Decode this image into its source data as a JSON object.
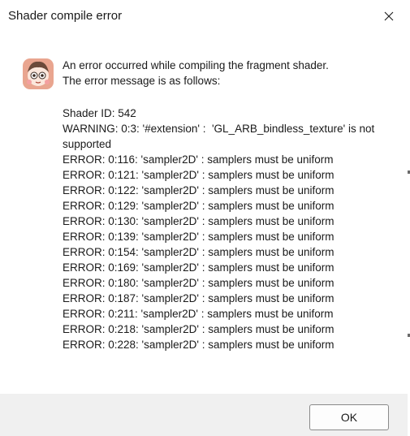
{
  "window": {
    "title": "Shader compile error",
    "close_icon": "close-icon"
  },
  "message": {
    "icon": "app-mascot-icon",
    "heading_line1": "An error occurred while compiling the fragment shader.",
    "heading_line2": "The error message is as follows:",
    "details": [
      "Shader ID: 542",
      "WARNING: 0:3: '#extension' :  'GL_ARB_bindless_texture' is not supported",
      "ERROR: 0:116: 'sampler2D' : samplers must be uniform",
      "ERROR: 0:121: 'sampler2D' : samplers must be uniform",
      "ERROR: 0:122: 'sampler2D' : samplers must be uniform",
      "ERROR: 0:129: 'sampler2D' : samplers must be uniform",
      "ERROR: 0:130: 'sampler2D' : samplers must be uniform",
      "ERROR: 0:139: 'sampler2D' : samplers must be uniform",
      "ERROR: 0:154: 'sampler2D' : samplers must be uniform",
      "ERROR: 0:169: 'sampler2D' : samplers must be uniform",
      "ERROR: 0:180: 'sampler2D' : samplers must be uniform",
      "ERROR: 0:187: 'sampler2D' : samplers must be uniform",
      "ERROR: 0:211: 'sampler2D' : samplers must be uniform",
      "ERROR: 0:218: 'sampler2D' : samplers must be uniform",
      "ERROR: 0:228: 'sampler2D' : samplers must be uniform"
    ]
  },
  "footer": {
    "ok_label": "OK"
  },
  "colors": {
    "footer_bg": "#f0f0f0",
    "text": "#1a1a1a",
    "button_border": "#8a8a8a"
  }
}
